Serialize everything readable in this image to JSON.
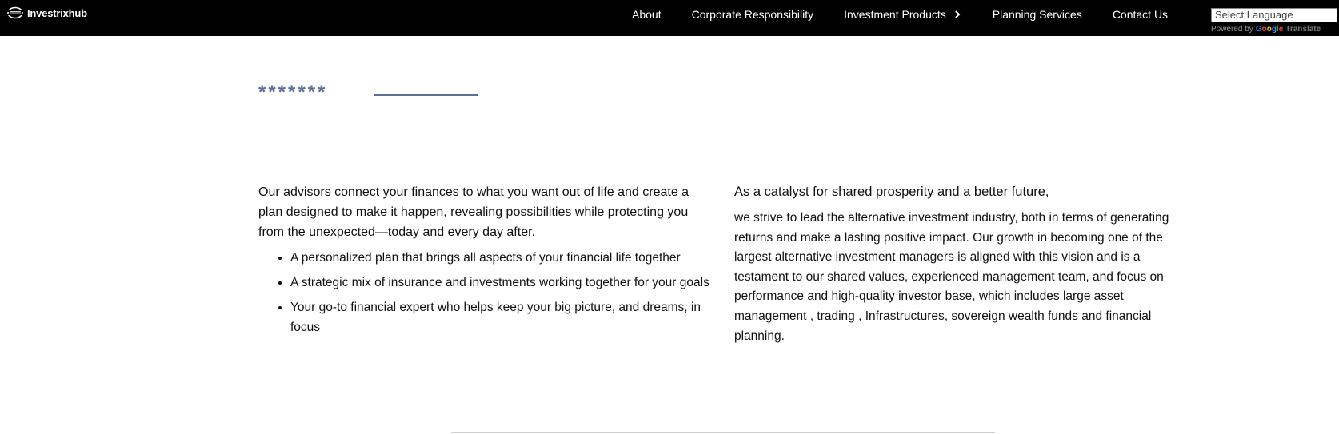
{
  "header": {
    "brand": "Investrixhub",
    "nav": [
      {
        "label": "About"
      },
      {
        "label": "Corporate Responsibility"
      },
      {
        "label": "Investment Products"
      },
      {
        "label": "Planning Services"
      },
      {
        "label": "Contact Us"
      }
    ],
    "language_select": {
      "selected": "Select Language"
    },
    "powered_by": "Powered by",
    "translate_word": "Translate"
  },
  "hero": {
    "stars": "*******"
  },
  "left": {
    "lead": "Our advisors connect your finances to what you want out of life and create a plan designed to make it happen, revealing possibilities while protecting you from the unexpected—today and every day after.",
    "bullets": [
      "A personalized plan that brings all aspects of your financial life together",
      "A strategic mix of insurance and investments working together for your goals",
      "Your go-to financial expert who helps keep your big picture, and dreams, in focus"
    ]
  },
  "right": {
    "lead": "As a catalyst for shared prosperity and a better future,",
    "body": "we strive to lead the alternative investment industry, both in terms of generating returns and make a lasting positive impact. Our growth in becoming one of the largest alternative investment managers is aligned with this vision and is a testament to our shared values, experienced management team, and focus on performance and high-quality investor base, which includes large asset management , trading , Infrastructures, sovereign wealth funds and financial planning."
  }
}
